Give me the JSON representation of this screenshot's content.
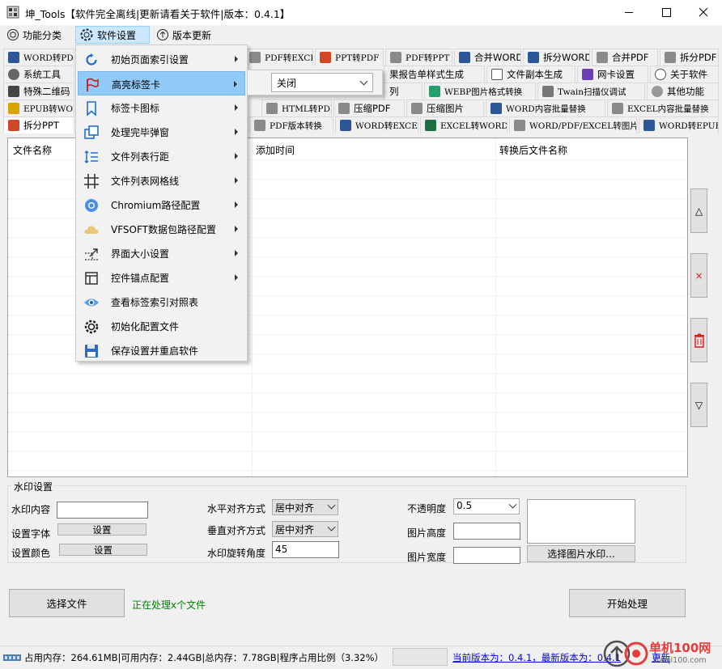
{
  "window": {
    "title": "坤_Tools【软件完全离线|更新请看关于软件|版本：0.4.1】"
  },
  "menubar": {
    "items": [
      "功能分类",
      "软件设置",
      "版本更新"
    ]
  },
  "tab_rows": [
    [
      "WORD转PDF",
      "PDF转EXCEL",
      "PPT转PDF",
      "PDF转PPT",
      "合并WORD",
      "拆分WORD",
      "合并PDF",
      "拆分PDF"
    ],
    [
      "系统工具",
      "果报告单样式生成",
      "文件副本生成",
      "网卡设置",
      "关于软件"
    ],
    [
      "特殊二维码",
      "列",
      "WEBP图片格式转换",
      "Twain扫描仪调试",
      "其他功能"
    ],
    [
      "EPUB转WORD",
      "HTML转PDF",
      "压缩PDF",
      "压缩图片",
      "WORD内容批量替换",
      "EXCEL内容批量替换"
    ],
    [
      "拆分PPT",
      "PDF版本转换",
      "WORD转EXCEL",
      "EXCEL转WORD",
      "WORD/PDF/EXCEL转图片",
      "WORD转EPUB"
    ]
  ],
  "filelist": {
    "columns": [
      "文件名称",
      "添加时间",
      "转换后文件名称"
    ]
  },
  "side_buttons": [
    "△",
    "×",
    "▽"
  ],
  "watermark": {
    "legend": "水印设置",
    "content_label": "水印内容",
    "content_value": "",
    "font_label": "设置字体",
    "font_btn": "设置",
    "color_label": "设置颜色",
    "color_btn": "设置",
    "halign_label": "水平对齐方式",
    "halign_value": "居中对齐",
    "valign_label": "垂直对齐方式",
    "valign_value": "居中对齐",
    "rotate_label": "水印旋转角度",
    "rotate_value": "45",
    "opacity_label": "不透明度",
    "opacity_value": "0.5",
    "img_height_label": "图片高度",
    "img_width_label": "图片宽度",
    "select_img_btn": "选择图片水印..."
  },
  "actions": {
    "select_files": "选择文件",
    "processing": "正在处理x个文件",
    "start": "开始处理"
  },
  "status": {
    "memory": "占用内存：264.61MB|可用内存：2.44GB|总内存：7.78GB|程序占用比例（3.32%）",
    "version": "当前版本为：0.4.1，最新版本为：0.4.1",
    "update_link": "更新"
  },
  "settings_menu": {
    "items": [
      {
        "label": "初始页面索引设置",
        "icon": "refresh-icon",
        "sub": true
      },
      {
        "label": "高亮标签卡",
        "icon": "red-flag-icon",
        "sub": true
      },
      {
        "label": "标签卡图标",
        "icon": "bookmark-icon",
        "sub": true
      },
      {
        "label": "处理完毕弹窗",
        "icon": "window-icon",
        "sub": true
      },
      {
        "label": "文件列表行距",
        "icon": "line-spacing-icon",
        "sub": true
      },
      {
        "label": "文件列表网格线",
        "icon": "grid-icon",
        "sub": true
      },
      {
        "label": "Chromium路径配置",
        "icon": "chromium-icon",
        "sub": true
      },
      {
        "label": "VFSOFT数据包路径配置",
        "icon": "cloud-icon",
        "sub": true
      },
      {
        "label": "界面大小设置",
        "icon": "resize-icon",
        "sub": true
      },
      {
        "label": "控件锚点配置",
        "icon": "layout-icon",
        "sub": true
      },
      {
        "label": "查看标签索引对照表",
        "icon": "eye-icon",
        "sub": false
      },
      {
        "label": "初始化配置文件",
        "icon": "gear-icon",
        "sub": false
      },
      {
        "label": "保存设置并重启软件",
        "icon": "save-icon",
        "sub": false
      }
    ],
    "submenu_value": "关闭"
  },
  "watermark_brand": {
    "name": "单机100网",
    "url": "danji100.com"
  },
  "colors": {
    "accent": "#0078d7",
    "highlight": "#91c9f7",
    "link": "#0000ee",
    "green_text": "#008000",
    "brand_red": "#e02020"
  }
}
